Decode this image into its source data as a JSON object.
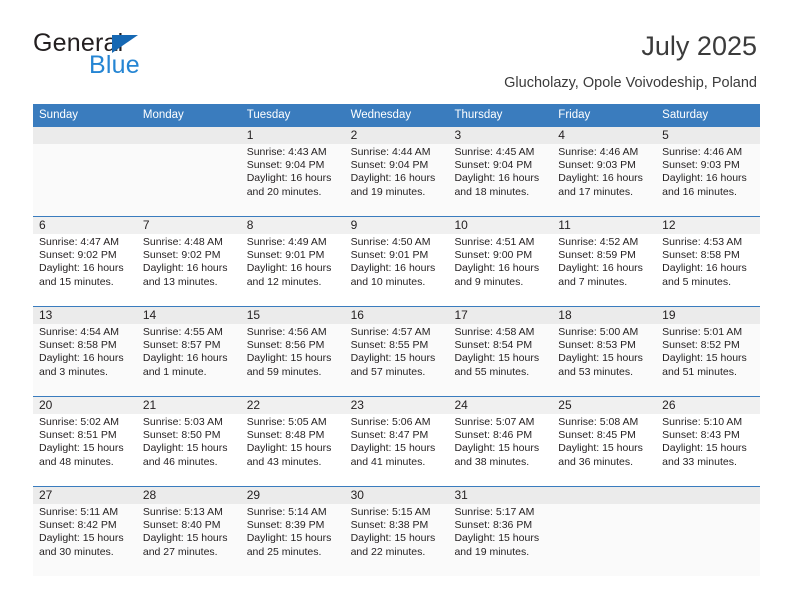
{
  "brand": {
    "name_part1": "General",
    "name_part2": "Blue",
    "accent_color": "#2585d3",
    "triangle_color": "#1668b3"
  },
  "header": {
    "title": "July 2025",
    "subtitle": "Glucholazy, Opole Voivodeship, Poland"
  },
  "calendar": {
    "header_bg": "#3a7cbe",
    "weekdays": [
      "Sunday",
      "Monday",
      "Tuesday",
      "Wednesday",
      "Thursday",
      "Friday",
      "Saturday"
    ],
    "weeks": [
      {
        "shaded": true,
        "days": [
          {
            "num": "",
            "sunrise": "",
            "sunset": "",
            "daylight": ""
          },
          {
            "num": "",
            "sunrise": "",
            "sunset": "",
            "daylight": ""
          },
          {
            "num": "1",
            "sunrise": "Sunrise: 4:43 AM",
            "sunset": "Sunset: 9:04 PM",
            "daylight": "Daylight: 16 hours and 20 minutes."
          },
          {
            "num": "2",
            "sunrise": "Sunrise: 4:44 AM",
            "sunset": "Sunset: 9:04 PM",
            "daylight": "Daylight: 16 hours and 19 minutes."
          },
          {
            "num": "3",
            "sunrise": "Sunrise: 4:45 AM",
            "sunset": "Sunset: 9:04 PM",
            "daylight": "Daylight: 16 hours and 18 minutes."
          },
          {
            "num": "4",
            "sunrise": "Sunrise: 4:46 AM",
            "sunset": "Sunset: 9:03 PM",
            "daylight": "Daylight: 16 hours and 17 minutes."
          },
          {
            "num": "5",
            "sunrise": "Sunrise: 4:46 AM",
            "sunset": "Sunset: 9:03 PM",
            "daylight": "Daylight: 16 hours and 16 minutes."
          }
        ]
      },
      {
        "shaded": false,
        "days": [
          {
            "num": "6",
            "sunrise": "Sunrise: 4:47 AM",
            "sunset": "Sunset: 9:02 PM",
            "daylight": "Daylight: 16 hours and 15 minutes."
          },
          {
            "num": "7",
            "sunrise": "Sunrise: 4:48 AM",
            "sunset": "Sunset: 9:02 PM",
            "daylight": "Daylight: 16 hours and 13 minutes."
          },
          {
            "num": "8",
            "sunrise": "Sunrise: 4:49 AM",
            "sunset": "Sunset: 9:01 PM",
            "daylight": "Daylight: 16 hours and 12 minutes."
          },
          {
            "num": "9",
            "sunrise": "Sunrise: 4:50 AM",
            "sunset": "Sunset: 9:01 PM",
            "daylight": "Daylight: 16 hours and 10 minutes."
          },
          {
            "num": "10",
            "sunrise": "Sunrise: 4:51 AM",
            "sunset": "Sunset: 9:00 PM",
            "daylight": "Daylight: 16 hours and 9 minutes."
          },
          {
            "num": "11",
            "sunrise": "Sunrise: 4:52 AM",
            "sunset": "Sunset: 8:59 PM",
            "daylight": "Daylight: 16 hours and 7 minutes."
          },
          {
            "num": "12",
            "sunrise": "Sunrise: 4:53 AM",
            "sunset": "Sunset: 8:58 PM",
            "daylight": "Daylight: 16 hours and 5 minutes."
          }
        ]
      },
      {
        "shaded": true,
        "days": [
          {
            "num": "13",
            "sunrise": "Sunrise: 4:54 AM",
            "sunset": "Sunset: 8:58 PM",
            "daylight": "Daylight: 16 hours and 3 minutes."
          },
          {
            "num": "14",
            "sunrise": "Sunrise: 4:55 AM",
            "sunset": "Sunset: 8:57 PM",
            "daylight": "Daylight: 16 hours and 1 minute."
          },
          {
            "num": "15",
            "sunrise": "Sunrise: 4:56 AM",
            "sunset": "Sunset: 8:56 PM",
            "daylight": "Daylight: 15 hours and 59 minutes."
          },
          {
            "num": "16",
            "sunrise": "Sunrise: 4:57 AM",
            "sunset": "Sunset: 8:55 PM",
            "daylight": "Daylight: 15 hours and 57 minutes."
          },
          {
            "num": "17",
            "sunrise": "Sunrise: 4:58 AM",
            "sunset": "Sunset: 8:54 PM",
            "daylight": "Daylight: 15 hours and 55 minutes."
          },
          {
            "num": "18",
            "sunrise": "Sunrise: 5:00 AM",
            "sunset": "Sunset: 8:53 PM",
            "daylight": "Daylight: 15 hours and 53 minutes."
          },
          {
            "num": "19",
            "sunrise": "Sunrise: 5:01 AM",
            "sunset": "Sunset: 8:52 PM",
            "daylight": "Daylight: 15 hours and 51 minutes."
          }
        ]
      },
      {
        "shaded": false,
        "days": [
          {
            "num": "20",
            "sunrise": "Sunrise: 5:02 AM",
            "sunset": "Sunset: 8:51 PM",
            "daylight": "Daylight: 15 hours and 48 minutes."
          },
          {
            "num": "21",
            "sunrise": "Sunrise: 5:03 AM",
            "sunset": "Sunset: 8:50 PM",
            "daylight": "Daylight: 15 hours and 46 minutes."
          },
          {
            "num": "22",
            "sunrise": "Sunrise: 5:05 AM",
            "sunset": "Sunset: 8:48 PM",
            "daylight": "Daylight: 15 hours and 43 minutes."
          },
          {
            "num": "23",
            "sunrise": "Sunrise: 5:06 AM",
            "sunset": "Sunset: 8:47 PM",
            "daylight": "Daylight: 15 hours and 41 minutes."
          },
          {
            "num": "24",
            "sunrise": "Sunrise: 5:07 AM",
            "sunset": "Sunset: 8:46 PM",
            "daylight": "Daylight: 15 hours and 38 minutes."
          },
          {
            "num": "25",
            "sunrise": "Sunrise: 5:08 AM",
            "sunset": "Sunset: 8:45 PM",
            "daylight": "Daylight: 15 hours and 36 minutes."
          },
          {
            "num": "26",
            "sunrise": "Sunrise: 5:10 AM",
            "sunset": "Sunset: 8:43 PM",
            "daylight": "Daylight: 15 hours and 33 minutes."
          }
        ]
      },
      {
        "shaded": true,
        "days": [
          {
            "num": "27",
            "sunrise": "Sunrise: 5:11 AM",
            "sunset": "Sunset: 8:42 PM",
            "daylight": "Daylight: 15 hours and 30 minutes."
          },
          {
            "num": "28",
            "sunrise": "Sunrise: 5:13 AM",
            "sunset": "Sunset: 8:40 PM",
            "daylight": "Daylight: 15 hours and 27 minutes."
          },
          {
            "num": "29",
            "sunrise": "Sunrise: 5:14 AM",
            "sunset": "Sunset: 8:39 PM",
            "daylight": "Daylight: 15 hours and 25 minutes."
          },
          {
            "num": "30",
            "sunrise": "Sunrise: 5:15 AM",
            "sunset": "Sunset: 8:38 PM",
            "daylight": "Daylight: 15 hours and 22 minutes."
          },
          {
            "num": "31",
            "sunrise": "Sunrise: 5:17 AM",
            "sunset": "Sunset: 8:36 PM",
            "daylight": "Daylight: 15 hours and 19 minutes."
          },
          {
            "num": "",
            "sunrise": "",
            "sunset": "",
            "daylight": ""
          },
          {
            "num": "",
            "sunrise": "",
            "sunset": "",
            "daylight": ""
          }
        ]
      }
    ]
  }
}
